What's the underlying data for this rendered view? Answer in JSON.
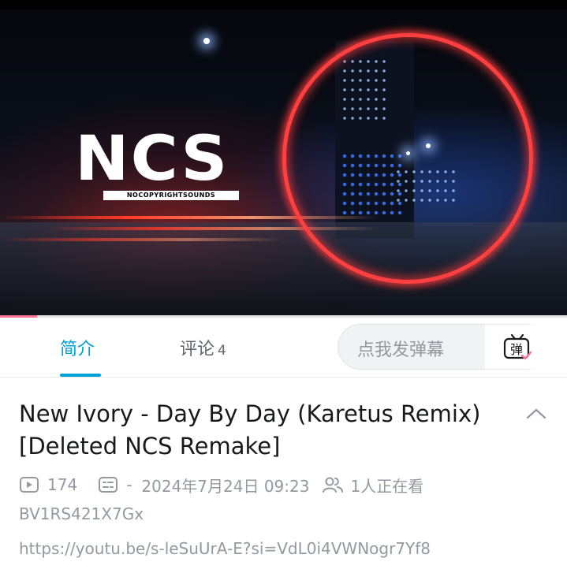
{
  "video": {
    "logo_text": "NCS",
    "logo_subtext": "NOCOPYRIGHTSOUNDS",
    "progress_fraction": 0.065
  },
  "tabs": [
    {
      "label": "简介",
      "active": true
    },
    {
      "label": "评论",
      "count": "4",
      "active": false
    }
  ],
  "danmaku": {
    "placeholder": "点我发弹幕",
    "button_glyph": "弹"
  },
  "info": {
    "title": "New Ivory - Day By Day (Karetus Remix) [Deleted NCS Remake]",
    "views": "174",
    "danmaku_count": "-",
    "date": "2024年7月24日 09:23",
    "watching": "1人正在看",
    "bvid": "BV1RS421X7Gx",
    "link": "https://youtu.be/s-leSuUrA-E?si=VdL0i4VWNogr7Yf8"
  },
  "colors": {
    "accent": "#00a1d6",
    "progress": "#fb7299",
    "muted_text": "#9499a0",
    "title_text": "#18191c"
  },
  "icons": [
    "play-count-icon",
    "danmaku-count-icon",
    "watching-people-icon",
    "danmaku-toggle-icon",
    "chevron-up-icon"
  ]
}
